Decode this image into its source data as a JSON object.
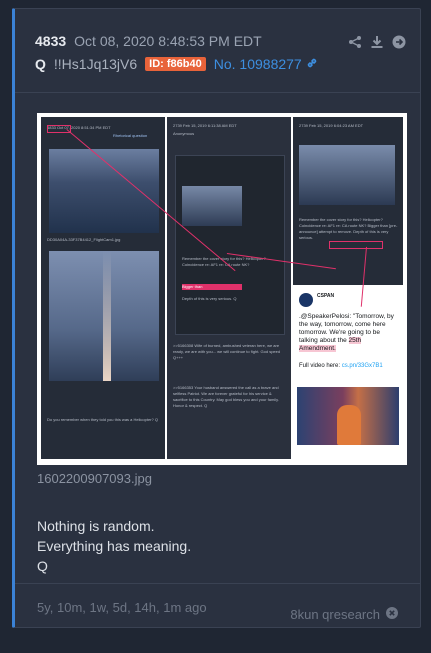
{
  "post": {
    "number": "4833",
    "date": "Oct 08, 2020 8:48:53 PM EDT",
    "author": "Q",
    "tripcode": "!!Hs1Jq13jV6",
    "id_badge": "ID: f86b40",
    "post_link": "No. 10988277"
  },
  "image": {
    "filename": "1602200907093.jpg",
    "panel_1": {
      "post": "4833 Oct 07, 2020 8:51:34 PM EDT",
      "link": "Rhetorical question",
      "filename": "DD30A04A-33F37B4412_FlightCam1.jpg",
      "caption": "Do you remember when they told you this was a Helicopter? Q"
    },
    "panel_2": {
      "post": "2739 Feb 15, 2019 6:11:38 AM EDT",
      "author": "Anonymous",
      "text_1": "Remember the cover story for this? Helicopter? Coincidence re: AF1 re: CA route NK?",
      "highlight": "Bigger than",
      "text_2": "Depth of this is very serious. Q",
      "text_3": ">>5166308 Wife of burned, ambushed veteran here, we are ready, we are with you... we will continue to fight. God speed Q+++",
      "text_4": ">>5166353 Your husband answered the call as a brave and selfless Patriot. We are forever grateful for his service & sacrifice to this Country. May god bless you and your family. Honor & respect. Q"
    },
    "panel_3": {
      "post": "2739 Feb 15, 2019 6:04:23 AM EDT",
      "text": "Remember the cover story for this? Helicopter? Coincidence re: AF1 re: CA route NK? Bigger than [pre-announce] attempt to remove. Depth of this is very serious."
    },
    "tweet": {
      "account": "CSPAN",
      "text_1": ".@SpeakerPelosi: \"Tomorrow, by the way, tomorrow, come here tomorrow. We're going to be talking about the ",
      "highlight": "25th Amendment.",
      "link_label": "Full video here:",
      "link": "cs.pn/33Gx7B1"
    }
  },
  "message": [
    "Nothing is random.",
    "Everything has meaning.",
    "Q"
  ],
  "footer": {
    "age": "5y, 10m, 1w, 5d, 14h, 1m ago",
    "source": "8kun qresearch"
  },
  "colors": {
    "accent": "#3b82d6",
    "id_badge": "#e8633a",
    "link": "#3d8fe0",
    "highlight": "#e0316a"
  },
  "icons": {
    "share": "share-icon",
    "download": "download-icon",
    "goto": "arrow-right-circle-icon",
    "link": "link-icon",
    "close": "close-circle-icon"
  }
}
